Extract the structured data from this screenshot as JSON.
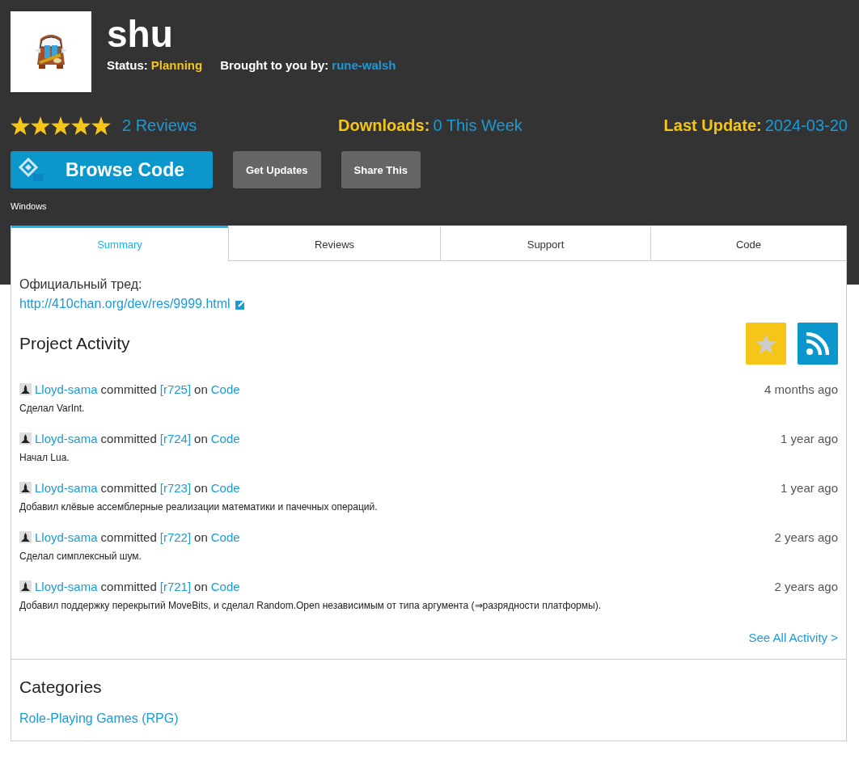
{
  "project": {
    "name": "shu",
    "status_label": "Status:",
    "status": "Planning",
    "author_label": "Brought to you by:",
    "author": "rune-walsh"
  },
  "stats": {
    "stars": 5,
    "reviews": "2 Reviews",
    "downloads_label": "Downloads:",
    "downloads": "0 This Week",
    "update_label": "Last Update:",
    "update": "2024-03-20"
  },
  "buttons": {
    "browse": "Browse Code",
    "updates": "Get Updates",
    "share": "Share This"
  },
  "platform": "Windows",
  "tabs": [
    {
      "label": "Summary",
      "selected": true
    },
    {
      "label": "Reviews",
      "selected": false
    },
    {
      "label": "Support",
      "selected": false
    },
    {
      "label": "Code",
      "selected": false
    }
  ],
  "summary": {
    "label": "Официальный тред:",
    "link": "http://410chan.org/dev/res/9999.html"
  },
  "activity": {
    "title": "Project Activity",
    "see_all": "See All Activity >",
    "items": [
      {
        "user": "Lloyd-sama",
        "verb": "committed",
        "rev": "[r725]",
        "on": "on",
        "repo": "Code",
        "time": "4 months ago",
        "message": "Сделал VarInt."
      },
      {
        "user": "Lloyd-sama",
        "verb": "committed",
        "rev": "[r724]",
        "on": "on",
        "repo": "Code",
        "time": "1 year ago",
        "message": "Начал Lua."
      },
      {
        "user": "Lloyd-sama",
        "verb": "committed",
        "rev": "[r723]",
        "on": "on",
        "repo": "Code",
        "time": "1 year ago",
        "message": "Добавил клёвые ассемблерные реализации математики и пачечных операций."
      },
      {
        "user": "Lloyd-sama",
        "verb": "committed",
        "rev": "[r722]",
        "on": "on",
        "repo": "Code",
        "time": "2 years ago",
        "message": "Сделал симплексный шум."
      },
      {
        "user": "Lloyd-sama",
        "verb": "committed",
        "rev": "[r721]",
        "on": "on",
        "repo": "Code",
        "time": "2 years ago",
        "message": "Добавил поддержку перекрытий MoveBits, и сделал Random.Open независимым от типа аргумента (⇒разрядности платформы)."
      }
    ]
  },
  "categories": {
    "title": "Categories",
    "items": [
      "Role-Playing Games (RPG)"
    ]
  }
}
